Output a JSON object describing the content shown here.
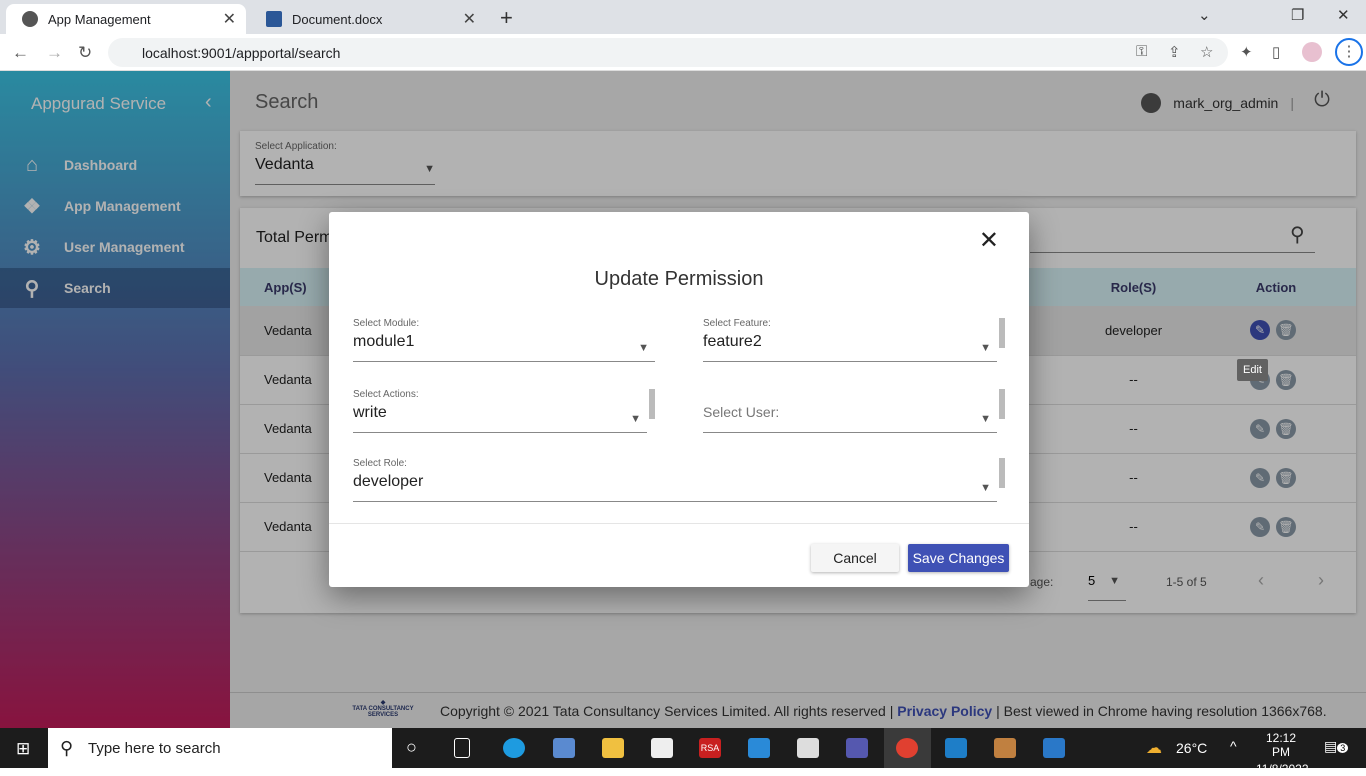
{
  "browser": {
    "tabs": [
      {
        "label": "App Management"
      },
      {
        "label": "Document.docx"
      }
    ],
    "url": "localhost:9001/appportal/search"
  },
  "sidebar": {
    "brand": "Appgurad Service",
    "items": [
      {
        "label": "Dashboard",
        "icon": "home-icon"
      },
      {
        "label": "App Management",
        "icon": "apps-icon"
      },
      {
        "label": "User Management",
        "icon": "user-gear-icon"
      },
      {
        "label": "Search",
        "icon": "search-icon",
        "active": true
      }
    ]
  },
  "header": {
    "title": "Search",
    "user": "mark_org_admin",
    "separator": "|"
  },
  "filter": {
    "label": "Select Application:",
    "value": "Vedanta"
  },
  "table": {
    "total_label": "Total Perm",
    "headers": [
      "App(S)",
      "Role(S)",
      "Action"
    ],
    "rows": [
      {
        "app": "Vedanta",
        "role": "developer"
      },
      {
        "app": "Vedanta",
        "role": "--"
      },
      {
        "app": "Vedanta",
        "role": "--"
      },
      {
        "app": "Vedanta",
        "role": "--"
      },
      {
        "app": "Vedanta",
        "role": "--"
      }
    ],
    "rows_per_page_label": "age:",
    "rows_per_page": "5",
    "range": "1-5 of 5",
    "edit_tooltip": "Edit"
  },
  "modal": {
    "title": "Update Permission",
    "module": {
      "label": "Select Module:",
      "value": "module1"
    },
    "feature": {
      "label": "Select Feature:",
      "value": "feature2"
    },
    "actions": {
      "label": "Select Actions:",
      "value": "write"
    },
    "user": {
      "placeholder": "Select User:"
    },
    "role": {
      "label": "Select Role:",
      "value": "developer"
    },
    "cancel": "Cancel",
    "save": "Save Changes"
  },
  "footer": {
    "logo_text": "TATA CONSULTANCY SERVICES",
    "copyright": "Copyright © 2021 Tata Consultancy Services Limited. All rights reserved |",
    "privacy": "Privacy Policy",
    "rest": "| Best viewed in Chrome having resolution 1366x768."
  },
  "taskbar": {
    "search_placeholder": "Type here to search",
    "weather": "26°C",
    "time": "12:12 PM",
    "date": "11/8/2022",
    "notifications": "3"
  },
  "colors": {
    "accent": "#3f51b5"
  }
}
